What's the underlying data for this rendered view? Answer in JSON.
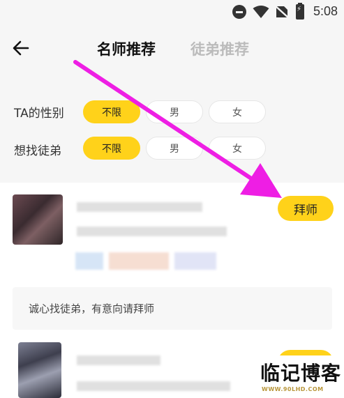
{
  "status_bar": {
    "time": "5:08",
    "icons": [
      "dnd-icon",
      "wifi-icon",
      "no-sim-icon",
      "battery-charging-icon"
    ]
  },
  "header": {
    "back_icon": "back-arrow-icon",
    "tabs": [
      {
        "label": "名师推荐",
        "active": true
      },
      {
        "label": "徒弟推荐",
        "active": false
      }
    ]
  },
  "filters": [
    {
      "label": "TA的性别",
      "options": [
        "不限",
        "男",
        "女"
      ],
      "selected": "不限"
    },
    {
      "label": "想找徒弟",
      "options": [
        "不限",
        "男",
        "女"
      ],
      "selected": "不限"
    }
  ],
  "list": [
    {
      "button_label": "拜师",
      "intro": "诚心找徒弟，有意向请拜师"
    },
    {
      "button_label": ""
    }
  ],
  "watermark": {
    "main": "临记博客",
    "sub": "WWW.90LHD.COM"
  },
  "colors": {
    "accent": "#ffd21a",
    "arrow": "#ee1ee4"
  }
}
